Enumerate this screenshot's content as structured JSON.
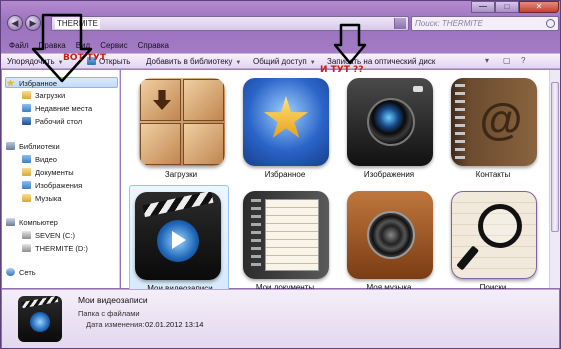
{
  "address": {
    "crumb": "THERMITE"
  },
  "search": {
    "placeholder": "Поиск: THERMITE"
  },
  "window_controls": {
    "minimize": "—",
    "maximize": "□",
    "close": "✕"
  },
  "menu": [
    "Файл",
    "Правка",
    "Вид",
    "Сервис",
    "Справка"
  ],
  "toolbar": {
    "organize": "Упорядочить",
    "open": "Открыть",
    "add_library": "Добавить в библиотеку",
    "share": "Общий доступ",
    "burn": "Записать на оптический диск"
  },
  "nav": {
    "favorites": "Избранное",
    "downloads": "Загрузки",
    "recent": "Недавние места",
    "desktop": "Рабочий стол",
    "libraries": "Библиотеки",
    "video": "Видео",
    "documents": "Документы",
    "pictures": "Изображения",
    "music": "Музыка",
    "computer": "Компьютер",
    "drive_c": "SEVEN (C:)",
    "drive_d": "THERMITE (D:)",
    "network": "Сеть"
  },
  "tiles": [
    {
      "label": "Загрузки",
      "icon": "downloads-icon"
    },
    {
      "label": "Избранное",
      "icon": "favorites-icon"
    },
    {
      "label": "Изображения",
      "icon": "camera-icon"
    },
    {
      "label": "Контакты",
      "icon": "contacts-icon"
    },
    {
      "label": "Мои видеозаписи",
      "icon": "video-icon",
      "selected": true
    },
    {
      "label": "Мои документы",
      "icon": "documents-icon"
    },
    {
      "label": "Моя музыка",
      "icon": "speaker-icon"
    },
    {
      "label": "Поиски",
      "icon": "search-magnifier-icon"
    }
  ],
  "details": {
    "name": "Мои видеозаписи",
    "type": "Папка с файлами",
    "modified_label": "Дата изменения:",
    "modified_value": "02.01.2012 13:14"
  },
  "annotations": {
    "left": "ВОТ ТУТ",
    "right": "И ТУТ ??"
  },
  "colors": {
    "annotation": "#d01818",
    "selection": "#c1dbf6",
    "frame": "#9a72bd"
  }
}
